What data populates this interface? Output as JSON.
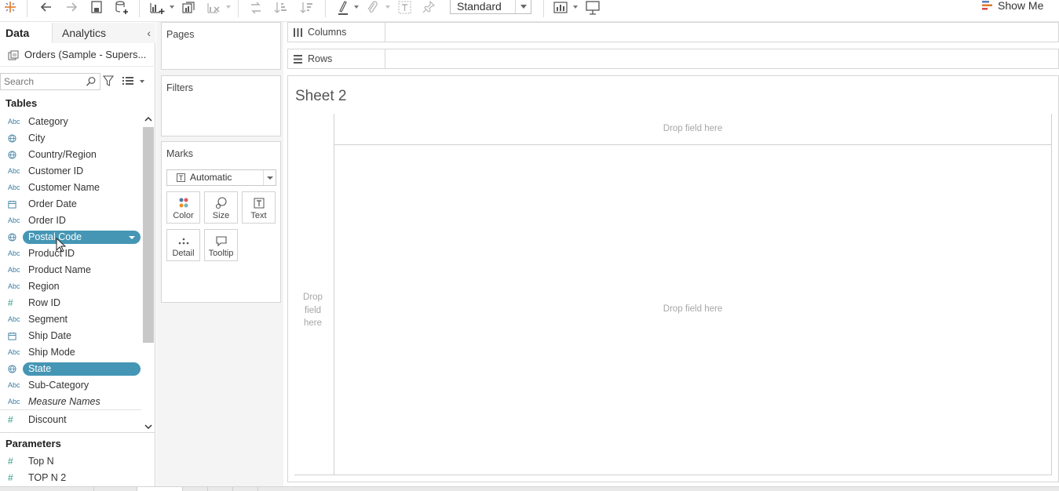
{
  "toolbar": {
    "marks_size": "Standard",
    "show_me": "Show Me"
  },
  "data_pane": {
    "tab_data": "Data",
    "tab_analytics": "Analytics",
    "datasource": "Orders (Sample - Supers...",
    "search_placeholder": "Search",
    "tables_title": "Tables",
    "fields": [
      {
        "name": "Category",
        "type": "Abc"
      },
      {
        "name": "City",
        "type": "geo"
      },
      {
        "name": "Country/Region",
        "type": "geo"
      },
      {
        "name": "Customer ID",
        "type": "Abc"
      },
      {
        "name": "Customer Name",
        "type": "Abc"
      },
      {
        "name": "Order Date",
        "type": "date"
      },
      {
        "name": "Order ID",
        "type": "Abc"
      },
      {
        "name": "Postal Code",
        "type": "geo",
        "selected": true
      },
      {
        "name": "Product ID",
        "type": "Abc"
      },
      {
        "name": "Product Name",
        "type": "Abc"
      },
      {
        "name": "Region",
        "type": "Abc"
      },
      {
        "name": "Row ID",
        "type": "#"
      },
      {
        "name": "Segment",
        "type": "Abc"
      },
      {
        "name": "Ship Date",
        "type": "date"
      },
      {
        "name": "Ship Mode",
        "type": "Abc"
      },
      {
        "name": "State",
        "type": "geo",
        "selected": true
      },
      {
        "name": "Sub-Category",
        "type": "Abc"
      },
      {
        "name": "Measure Names",
        "type": "Abc",
        "italic": true
      },
      {
        "name": "Discount",
        "type": "#"
      }
    ],
    "parameters_title": "Parameters",
    "parameters": [
      {
        "name": "Top N",
        "type": "#"
      },
      {
        "name": "TOP N 2",
        "type": "#"
      }
    ],
    "type_label_abc": "Abc"
  },
  "cards": {
    "pages": "Pages",
    "filters": "Filters",
    "marks": "Marks",
    "mark_type": "Automatic",
    "buttons": {
      "color": "Color",
      "size": "Size",
      "text": "Text",
      "detail": "Detail",
      "tooltip": "Tooltip"
    }
  },
  "shelves": {
    "columns": "Columns",
    "rows": "Rows"
  },
  "sheet": {
    "title": "Sheet 2",
    "drop_top": "Drop field here",
    "drop_left_1": "Drop",
    "drop_left_2": "field",
    "drop_left_3": "here",
    "drop_main": "Drop field here"
  },
  "colors": {
    "accent": "#4596b5",
    "pill_text": "#ffffff",
    "dimension_icon": "#3b7ea1",
    "measure_icon": "#2e9c8a"
  },
  "icons": [
    "tableau-logo-icon",
    "undo-icon",
    "redo-icon",
    "save-icon",
    "new-datasource-icon",
    "new-worksheet-icon",
    "duplicate-icon",
    "clear-icon",
    "swap-icon",
    "sort-asc-icon",
    "sort-desc-icon",
    "highlight-icon",
    "group-icon",
    "label-icon",
    "pin-icon",
    "show-cards-icon",
    "presentation-icon",
    "show-me-icon",
    "search-icon",
    "filter-icon",
    "view-icon",
    "columns-icon",
    "rows-icon"
  ]
}
